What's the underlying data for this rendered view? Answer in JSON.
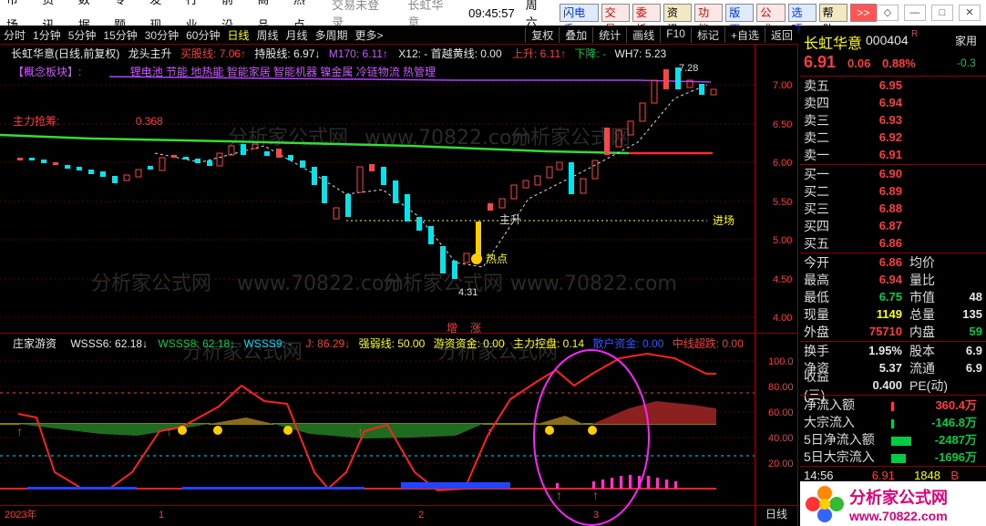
{
  "menubar": {
    "items": [
      "市场",
      "资讯",
      "数据",
      "专题",
      "发现",
      "行业",
      "前沿",
      "商品",
      "热点"
    ],
    "status": "交易未登录",
    "stock": "长虹华意",
    "time": "09:45:57",
    "weekday": "周六",
    "buttons": [
      "闪电手",
      "交易",
      "委托",
      "资讯",
      "功能",
      "版面",
      "公式",
      "选项",
      "帮助",
      ">>"
    ]
  },
  "toolbar": {
    "periods": [
      "分时",
      "1分钟",
      "5分钟",
      "15分钟",
      "30分钟",
      "60分钟",
      "日线",
      "周线",
      "月线",
      "多周期",
      "更多>"
    ],
    "active": "日线",
    "right": [
      "复权",
      "叠加",
      "统计",
      "画线",
      "F10",
      "标记",
      "+自选",
      "返回"
    ]
  },
  "main": {
    "title": "长虹华意(日线,前复权)",
    "indicator": "龙头主升",
    "buy_line": "买股线: 7.06↑",
    "hold_line": "持股线: 6.97↓",
    "m170": "M170: 6.11↑",
    "x12": "X12: - 首越黄线: 0.00",
    "up": "上升: 6.11↑",
    "down": "下降: -",
    "wh7": "WH7: 5.23",
    "concept": "【概念板块】:",
    "concepts": "锂电池 节能 地热能 智能家居 智能机器 镍金属 冷链物流 热管理",
    "main_force": "主力抢筹:",
    "main_force_val": "0.368",
    "high_label": "7.28",
    "low_label": "4.31",
    "hot_label": "热点",
    "rise_label": "主升",
    "entry_label": "进场",
    "add_label": "增",
    "rise2_label": "涨",
    "y_ticks": [
      "7.00",
      "6.50",
      "6.00",
      "5.50",
      "5.00",
      "4.50",
      "4.00"
    ]
  },
  "sub": {
    "name": "庄家游资",
    "wsss6": "WSSS6: 62.18↓",
    "wsss8": "WSSS8: 62.18↓",
    "wsss9": "WSSS9: -",
    "j": "J: 86.29↓",
    "strong": "强弱线: 50.00",
    "youzi": "游资资金: 0.00",
    "zhuli": "主力控盘: 0.14",
    "sanhu": "散户资金: 0.00",
    "zhongxian": "中线超跌: 0.00",
    "y_ticks": [
      "100.0",
      "80.00",
      "60.00",
      "40.00",
      "20.00"
    ]
  },
  "xaxis": {
    "labels": [
      "2023年",
      "1",
      "2",
      "3"
    ],
    "right": "日线"
  },
  "quote": {
    "name": "长虹华意",
    "code": "000404",
    "badge": "R",
    "extra": "家用",
    "price": "6.91",
    "change": "0.06",
    "pct": "0.88%",
    "extra2": "-0.3",
    "asks": [
      {
        "l": "卖五",
        "p": "6.95"
      },
      {
        "l": "卖四",
        "p": "6.94"
      },
      {
        "l": "卖三",
        "p": "6.93"
      },
      {
        "l": "卖二",
        "p": "6.92"
      },
      {
        "l": "卖一",
        "p": "6.91"
      }
    ],
    "bids": [
      {
        "l": "买一",
        "p": "6.90"
      },
      {
        "l": "买二",
        "p": "6.89"
      },
      {
        "l": "买三",
        "p": "6.88"
      },
      {
        "l": "买四",
        "p": "6.87"
      },
      {
        "l": "买五",
        "p": "6.86"
      }
    ],
    "stats": [
      {
        "a": "今开",
        "av": "6.86",
        "b": "均价",
        "bv": ""
      },
      {
        "a": "最高",
        "av": "6.94",
        "b": "量比",
        "bv": ""
      },
      {
        "a": "最低",
        "av": "6.75",
        "b": "市值",
        "bv": "48"
      },
      {
        "a": "现量",
        "av": "1149",
        "b": "总量",
        "bv": "135"
      },
      {
        "a": "外盘",
        "av": "75710",
        "b": "内盘",
        "bv": "59"
      }
    ],
    "stats2": [
      {
        "a": "换手",
        "av": "1.95%",
        "b": "股本",
        "bv": "6.9"
      },
      {
        "a": "净资",
        "av": "5.37",
        "b": "流通",
        "bv": "6.9"
      },
      {
        "a": "收益(三)",
        "av": "0.400",
        "b": "PE(动)",
        "bv": ""
      }
    ],
    "flows": [
      {
        "l": "净流入额",
        "v": "360.4万"
      },
      {
        "l": "大宗流入",
        "v": "-146.8万"
      },
      {
        "l": "5日净流入额",
        "v": "-2487万"
      },
      {
        "l": "5日大宗流入",
        "v": "-1696万"
      }
    ],
    "tick": {
      "t": "14:56",
      "p": "6.91",
      "v": "1848",
      "f": "B"
    }
  },
  "watermark": {
    "text1": "分析家公式网",
    "text2": "www.70822.com"
  }
}
